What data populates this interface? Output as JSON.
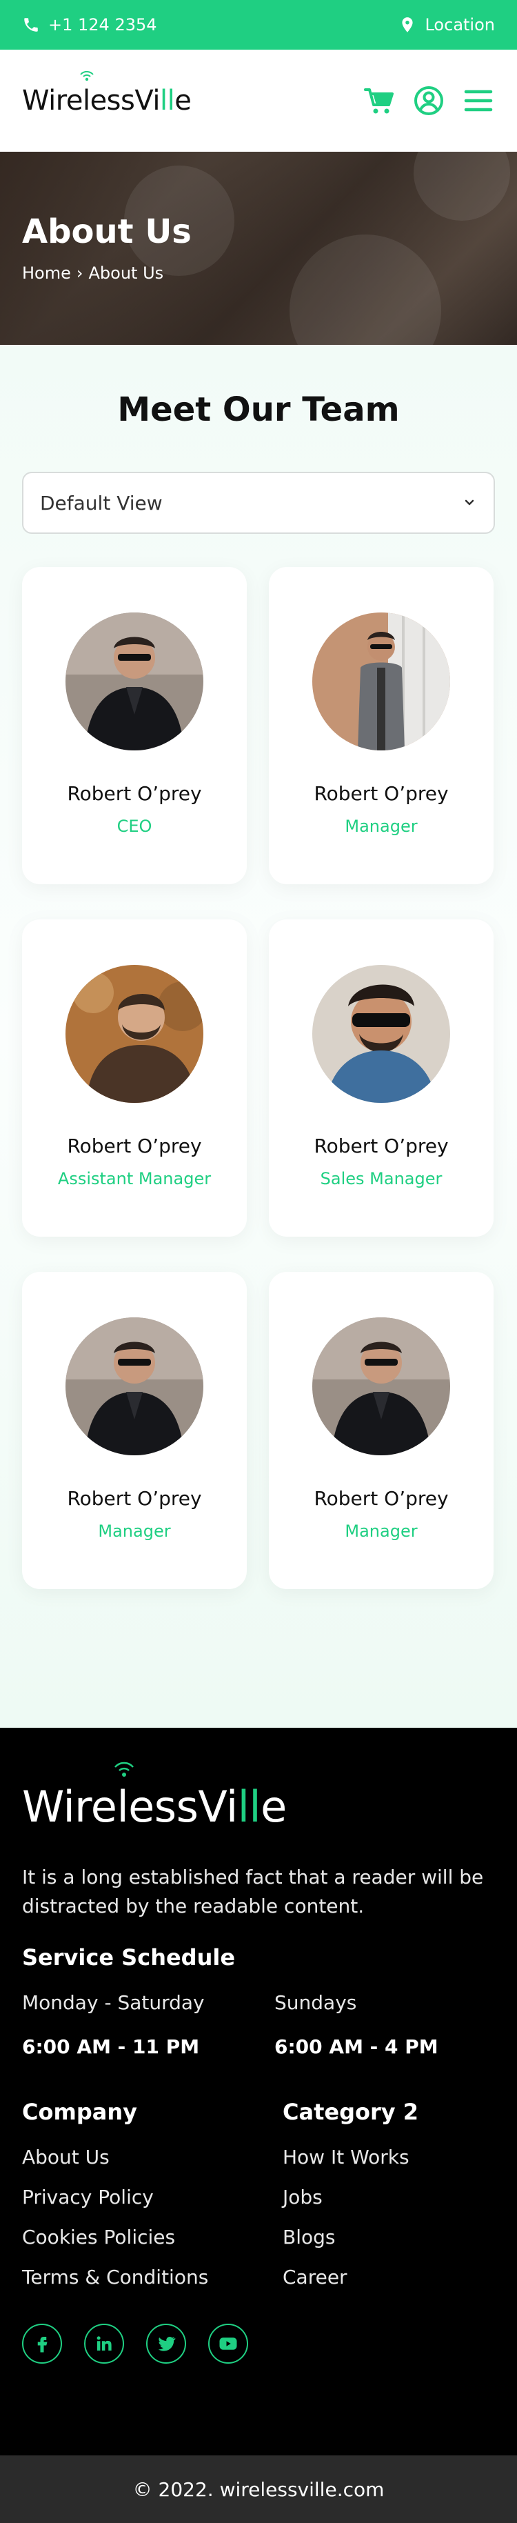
{
  "topbar": {
    "phone": "+1 124 2354",
    "location": "Location"
  },
  "header": {
    "logo_main": "WirelessVi",
    "logo_accent": "ll",
    "logo_end": "e"
  },
  "hero": {
    "title": "About Us",
    "breadcrumb_home": "Home",
    "breadcrumb_sep": "›",
    "breadcrumb_current": "About Us"
  },
  "team": {
    "title": "Meet Our Team",
    "view_select": "Default View",
    "members": [
      {
        "name": "Robert O’prey",
        "role": "CEO"
      },
      {
        "name": "Robert O’prey",
        "role": "Manager"
      },
      {
        "name": "Robert O’prey",
        "role": "Assistant Manager"
      },
      {
        "name": "Robert O’prey",
        "role": "Sales Manager"
      },
      {
        "name": "Robert O’prey",
        "role": "Manager"
      },
      {
        "name": "Robert O’prey",
        "role": "Manager"
      }
    ]
  },
  "footer": {
    "logo_main": "WirelessVi",
    "logo_accent": "ll",
    "logo_end": "e",
    "about": "It is a long established fact that a reader will be distracted by the readable content.",
    "schedule_title": "Service Schedule",
    "schedule": [
      {
        "days": "Monday - Saturday",
        "hours": "6:00 AM - 11 PM"
      },
      {
        "days": "Sundays",
        "hours": "6:00 AM - 4 PM"
      }
    ],
    "company_title": "Company",
    "company_links": [
      "About Us",
      "Privacy Policy",
      "Cookies Policies",
      "Terms & Conditions"
    ],
    "category_title": "Category 2",
    "category_links": [
      "How It Works",
      "Jobs",
      "Blogs",
      "Career"
    ],
    "social": [
      "facebook-icon",
      "linkedin-icon",
      "twitter-icon",
      "youtube-icon"
    ]
  },
  "copyright": "© 2022. wirelessville.com",
  "colors": {
    "accent": "#1fcf82",
    "footer_bg": "#000000",
    "copyright_bg": "#2b2b2b"
  }
}
